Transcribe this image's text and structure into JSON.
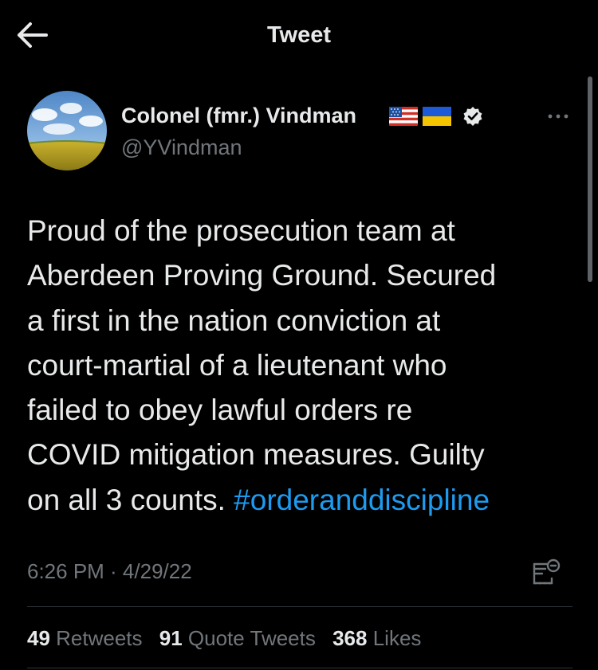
{
  "header": {
    "title": "Tweet",
    "back_icon": "arrow-left-icon"
  },
  "author": {
    "name": "Colonel (fmr.) Vindman",
    "handle": "@YVindman",
    "flags": [
      "us-flag-icon",
      "ukraine-flag-icon"
    ],
    "verified": true
  },
  "tweet": {
    "lines": [
      "Proud of the prosecution team at",
      "Aberdeen Proving Ground. Secured",
      "a first in the nation conviction at",
      "court-martial of a lieutenant who",
      "failed to obey lawful orders re",
      "COVID mitigation measures. Guilty",
      "on all 3 counts. "
    ],
    "hashtag": "#orderanddiscipline",
    "timestamp": "6:26 PM · 4/29/22"
  },
  "stats": {
    "retweets_count": "49",
    "retweets_label": " Retweets",
    "quotes_count": "91",
    "quotes_label": " Quote Tweets",
    "likes_count": "368",
    "likes_label": " Likes"
  },
  "colors": {
    "background": "#000000",
    "text": "#e7e9ea",
    "secondary": "#71767b",
    "link": "#1d9bf0",
    "divider": "#2f3336"
  }
}
